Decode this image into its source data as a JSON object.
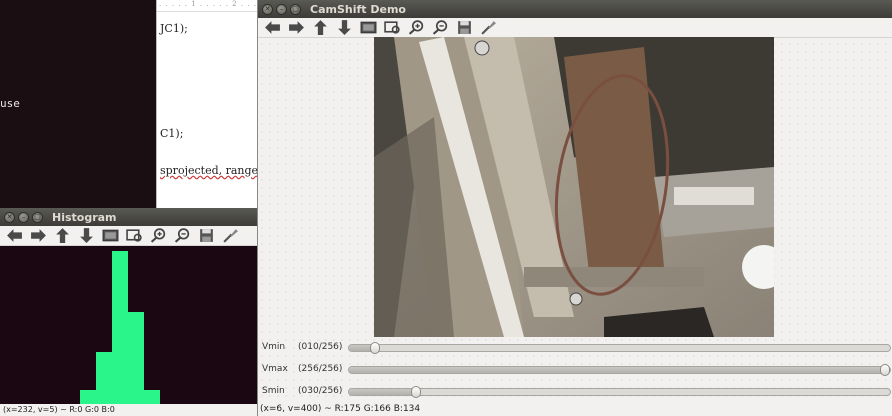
{
  "terminal": {
    "line": "use"
  },
  "editor": {
    "lines": [
      "JC1);",
      "C1);",
      "sprojected, ranges);"
    ]
  },
  "histogram_window": {
    "title": "Histogram",
    "status": "(x=232, v=5) ~ R:0 G:0 B:0",
    "bar_color": "#2af58a",
    "bars": [
      {
        "level": 0.13
      },
      {
        "level": 0.36
      },
      {
        "level": 0.97
      },
      {
        "level": 0.6
      },
      {
        "level": 0.13
      }
    ]
  },
  "camshift_window": {
    "title": "CamShift Demo",
    "status": "(x=6, v=400) ~ R:175 G:166 B:134",
    "sliders": [
      {
        "name": "Vmin",
        "value_text": "(010/256)",
        "fraction": 0.039
      },
      {
        "name": "Vmax",
        "value_text": "(256/256)",
        "fraction": 1.0
      },
      {
        "name": "Smin",
        "value_text": "(030/256)",
        "fraction": 0.117
      }
    ]
  },
  "toolbar_icons": [
    "arrow-left-icon",
    "arrow-right-icon",
    "arrow-up-icon",
    "arrow-down-icon",
    "image-icon",
    "zoom-fit-icon",
    "zoom-in-icon",
    "zoom-out-icon",
    "save-icon",
    "properties-icon"
  ]
}
